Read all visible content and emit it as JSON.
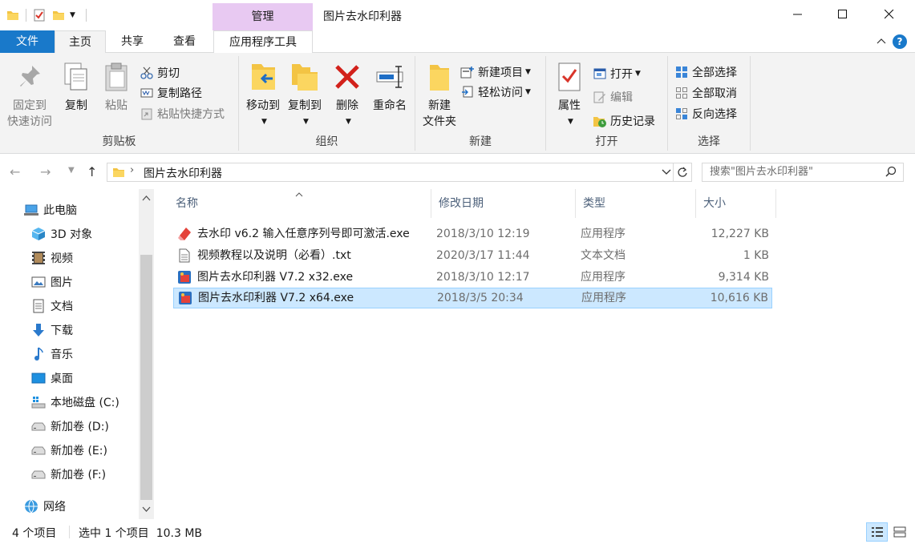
{
  "window": {
    "manage_tab": "管理",
    "title": "图片去水印利器"
  },
  "tabs": {
    "file": "文件",
    "home": "主页",
    "share": "共享",
    "view": "查看",
    "app_tools": "应用程序工具"
  },
  "ribbon": {
    "clipboard": {
      "label": "剪贴板",
      "pin": [
        "固定到",
        "快速访问"
      ],
      "copy": "复制",
      "paste": "粘贴",
      "cut": "剪切",
      "copy_path": "复制路径",
      "paste_shortcut": "粘贴快捷方式"
    },
    "organize": {
      "label": "组织",
      "move_to": "移动到",
      "copy_to": "复制到",
      "delete": "删除",
      "rename": "重命名"
    },
    "new": {
      "label": "新建",
      "new_folder": [
        "新建",
        "文件夹"
      ],
      "new_item": "新建项目",
      "easy_access": "轻松访问"
    },
    "open": {
      "label": "打开",
      "properties": "属性",
      "open": "打开",
      "edit": "编辑",
      "history": "历史记录"
    },
    "select": {
      "label": "选择",
      "select_all": "全部选择",
      "select_none": "全部取消",
      "invert": "反向选择"
    }
  },
  "address": {
    "path": "图片去水印利器",
    "search_placeholder": "搜索\"图片去水印利器\""
  },
  "nav": {
    "items": [
      {
        "label": "此电脑",
        "icon": "computer-icon"
      },
      {
        "label": "3D 对象",
        "icon": "3d-objects-icon"
      },
      {
        "label": "视频",
        "icon": "video-icon"
      },
      {
        "label": "图片",
        "icon": "pictures-icon"
      },
      {
        "label": "文档",
        "icon": "documents-icon"
      },
      {
        "label": "下载",
        "icon": "download-icon"
      },
      {
        "label": "音乐",
        "icon": "music-icon"
      },
      {
        "label": "桌面",
        "icon": "desktop-icon"
      },
      {
        "label": "本地磁盘 (C:)",
        "icon": "windows-drive-icon"
      },
      {
        "label": "新加卷 (D:)",
        "icon": "drive-icon"
      },
      {
        "label": "新加卷 (E:)",
        "icon": "drive-icon"
      },
      {
        "label": "新加卷 (F:)",
        "icon": "drive-icon"
      },
      {
        "label": "网络",
        "icon": "network-icon"
      }
    ]
  },
  "columns": {
    "name": "名称",
    "date": "修改日期",
    "type": "类型",
    "size": "大小"
  },
  "files": [
    {
      "name": "去水印 v6.2 输入任意序列号即可激活.exe",
      "date": "2018/3/10 12:19",
      "type": "应用程序",
      "size": "12,227 KB",
      "icon": "eraser-exe-icon"
    },
    {
      "name": "视频教程以及说明（必看）.txt",
      "date": "2020/3/17 11:44",
      "type": "文本文档",
      "size": "1 KB",
      "icon": "text-file-icon"
    },
    {
      "name": "图片去水印利器 V7.2 x32.exe",
      "date": "2018/3/10 12:17",
      "type": "应用程序",
      "size": "9,314 KB",
      "icon": "app-exe-icon"
    },
    {
      "name": "图片去水印利器 V7.2 x64.exe",
      "date": "2018/3/5 20:34",
      "type": "应用程序",
      "size": "10,616 KB",
      "icon": "app-exe-icon"
    }
  ],
  "status": {
    "count": "4 个项目",
    "selection": "选中 1 个项目  10.3 MB"
  },
  "colors": {
    "accent": "#1979ca",
    "manage_tab": "#e8c9f2",
    "selection": "#cce8ff"
  }
}
